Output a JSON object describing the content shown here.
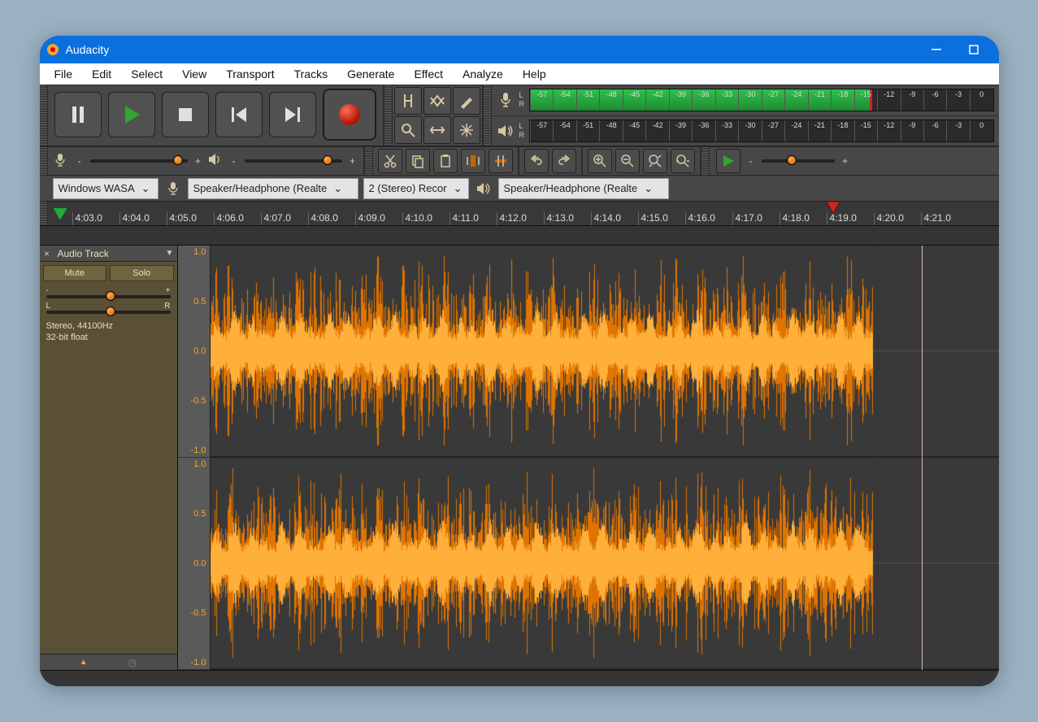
{
  "window": {
    "title": "Audacity"
  },
  "menu": [
    "File",
    "Edit",
    "Select",
    "View",
    "Transport",
    "Tracks",
    "Generate",
    "Effect",
    "Analyze",
    "Help"
  ],
  "meter": {
    "db_ticks": [
      "-57",
      "-54",
      "-51",
      "-48",
      "-45",
      "-42",
      "-39",
      "-36",
      "-33",
      "-30",
      "-27",
      "-24",
      "-21",
      "-18",
      "-15",
      "-12",
      "-9",
      "-6",
      "-3",
      "0"
    ],
    "rec_level_pct": 74
  },
  "devices": {
    "host": "Windows WASA",
    "rec_device": "Speaker/Headphone (Realte",
    "rec_channels": "2 (Stereo) Recor",
    "play_device": "Speaker/Headphone (Realte"
  },
  "timeline": {
    "ticks": [
      "4:03.0",
      "4:04.0",
      "4:05.0",
      "4:06.0",
      "4:07.0",
      "4:08.0",
      "4:09.0",
      "4:10.0",
      "4:11.0",
      "4:12.0",
      "4:13.0",
      "4:14.0",
      "4:15.0",
      "4:16.0",
      "4:17.0",
      "4:18.0",
      "4:19.0",
      "4:20.0",
      "4:21.0"
    ]
  },
  "track": {
    "name": "Audio Track",
    "mute": "Mute",
    "solo": "Solo",
    "gain_left": "-",
    "gain_right": "+",
    "pan_left": "L",
    "pan_right": "R",
    "info1": "Stereo, 44100Hz",
    "info2": "32-bit float",
    "amp_labels": [
      "1.0",
      "0.5",
      "0.0",
      "-0.5",
      "-1.0"
    ]
  },
  "mixer": {
    "rec_vol_pct": 85,
    "play_vol_pct": 80,
    "play_speed_pct": 35
  }
}
